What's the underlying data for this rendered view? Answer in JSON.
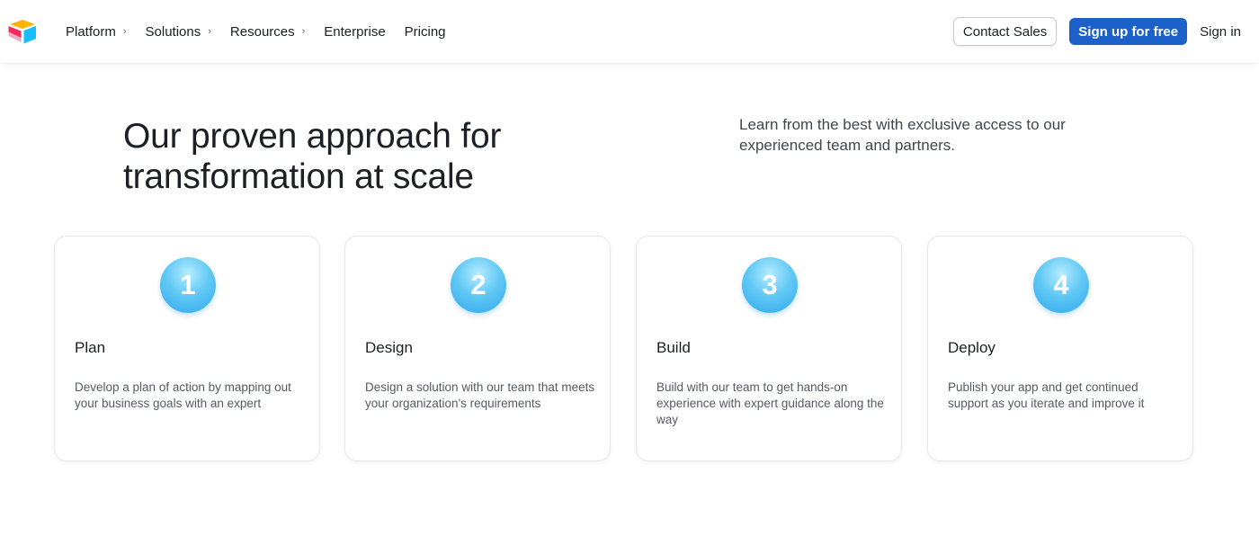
{
  "brand": {
    "logo_icon": "airtable-logo-icon",
    "colors": [
      "#fcb400",
      "#18bfff",
      "#f82b60"
    ]
  },
  "nav": {
    "items": [
      {
        "label": "Platform",
        "has_chevron": true
      },
      {
        "label": "Solutions",
        "has_chevron": true
      },
      {
        "label": "Resources",
        "has_chevron": true
      },
      {
        "label": "Enterprise",
        "has_chevron": false
      },
      {
        "label": "Pricing",
        "has_chevron": false
      }
    ],
    "chevron_glyph": "›"
  },
  "header_actions": {
    "contact_label": "Contact Sales",
    "signup_label": "Sign up for free",
    "signin_label": "Sign in",
    "accent_color": "#1b61c9"
  },
  "hero": {
    "title_line1": "Our proven approach for",
    "title_line2": "transformation at scale",
    "subtitle": "Learn from the best with exclusive access to our experienced team and partners."
  },
  "steps": [
    {
      "number": "1",
      "title": "Plan",
      "description": "Develop a plan of action by mapping out your business goals with an expert"
    },
    {
      "number": "2",
      "title": "Design",
      "description": "Design a solution with our team that meets your organization's requirements"
    },
    {
      "number": "3",
      "title": "Build",
      "description": "Build with our team to get hands-on experience with expert guidance along the way"
    },
    {
      "number": "4",
      "title": "Deploy",
      "description": "Publish your app and get continued support as you iterate and improve it"
    }
  ]
}
